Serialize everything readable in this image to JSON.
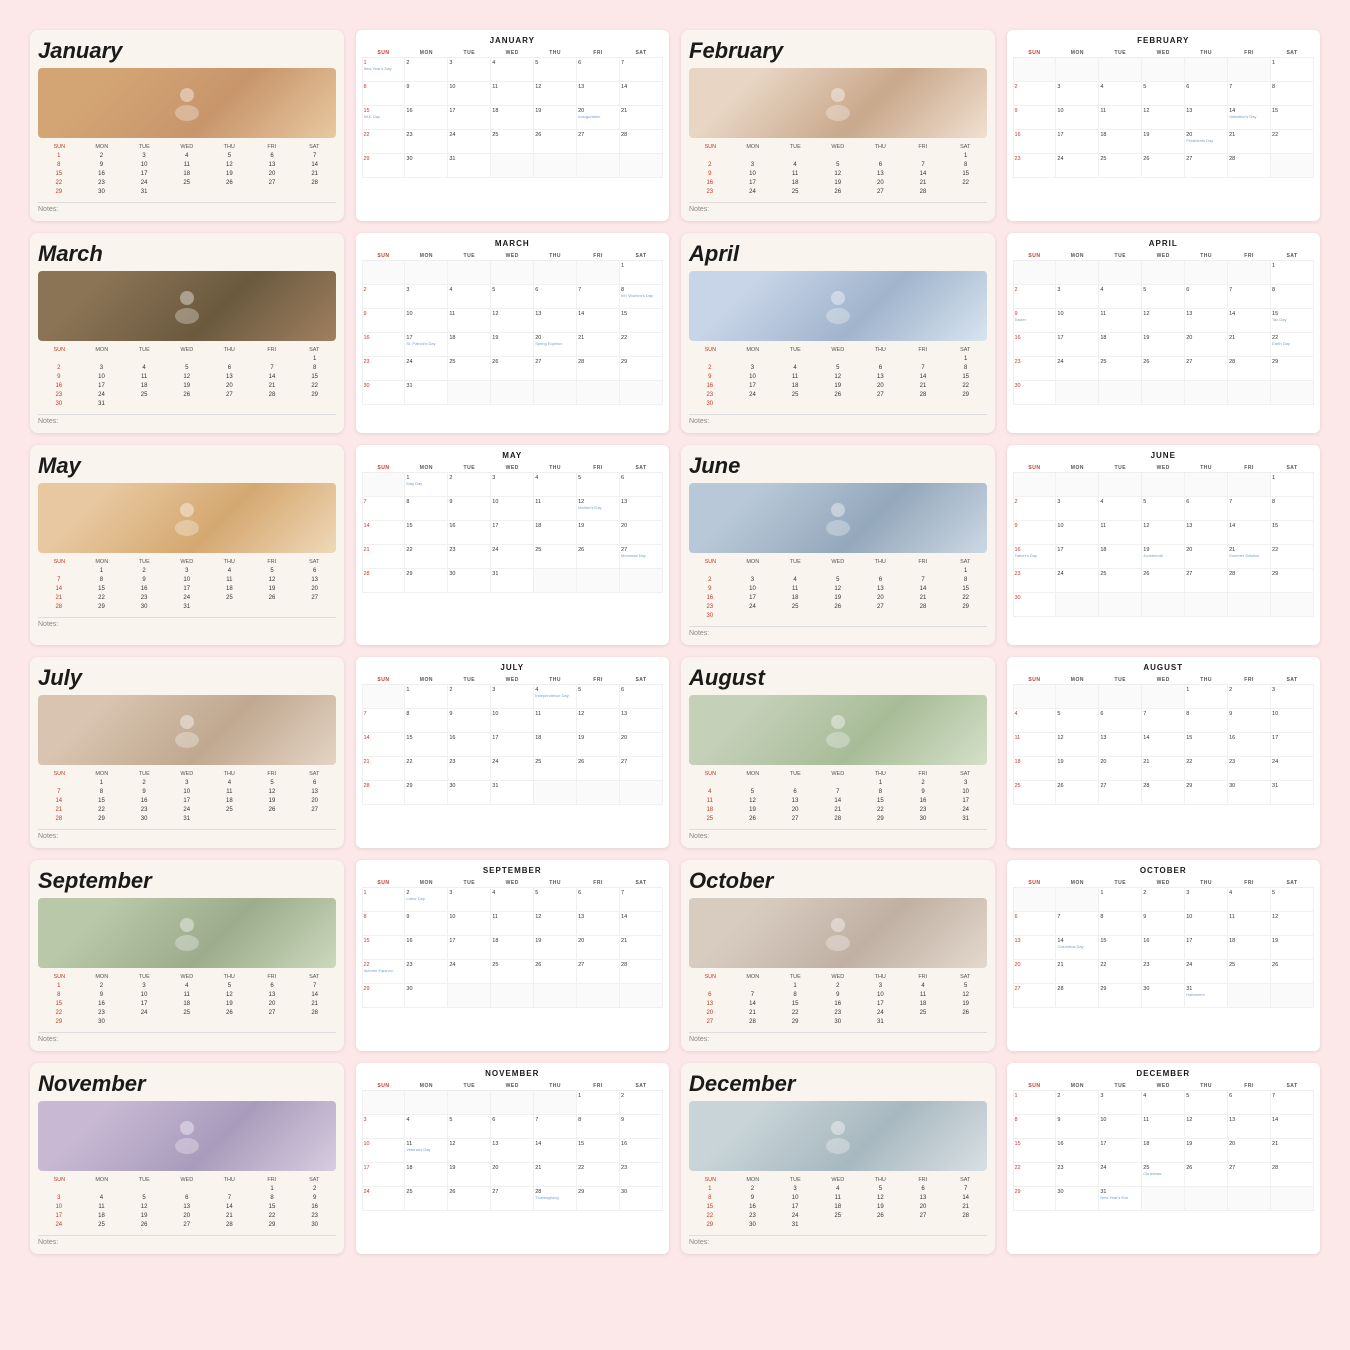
{
  "months": [
    {
      "id": "jan",
      "name": "January",
      "photoClass": "photo-jan",
      "photoLabel": "Woman at desk",
      "days": [
        1,
        2,
        3,
        4,
        5,
        6,
        7,
        8,
        9,
        10,
        11,
        12,
        13,
        14,
        15,
        16,
        17,
        18,
        19,
        20,
        21,
        22,
        23,
        24,
        25,
        26,
        27,
        28,
        29,
        30,
        31
      ],
      "startDay": 0,
      "events": {
        "1": "New Year's Day",
        "15": "MLK Day",
        "20": "Inauguration"
      }
    },
    {
      "id": "feb",
      "name": "February",
      "photoClass": "photo-feb",
      "photoLabel": "Women collaborating",
      "days": [
        1,
        2,
        3,
        4,
        5,
        6,
        7,
        8,
        9,
        10,
        11,
        12,
        13,
        14,
        15,
        16,
        17,
        18,
        19,
        20,
        21,
        22,
        23,
        24,
        25,
        26,
        27,
        28
      ],
      "startDay": 6,
      "events": {
        "14": "Valentine's Day",
        "20": "Presidents Day"
      }
    },
    {
      "id": "mar",
      "name": "March",
      "photoClass": "photo-mar",
      "photoLabel": "Women with laptops",
      "days": [
        1,
        2,
        3,
        4,
        5,
        6,
        7,
        8,
        9,
        10,
        11,
        12,
        13,
        14,
        15,
        16,
        17,
        18,
        19,
        20,
        21,
        22,
        23,
        24,
        25,
        26,
        27,
        28,
        29,
        30,
        31
      ],
      "startDay": 6,
      "events": {
        "8": "Int'l Women's Day",
        "17": "St. Patrick's Day",
        "20": "Spring Equinox"
      }
    },
    {
      "id": "apr",
      "name": "April",
      "photoClass": "photo-apr",
      "photoLabel": "Team meeting",
      "days": [
        1,
        2,
        3,
        4,
        5,
        6,
        7,
        8,
        9,
        10,
        11,
        12,
        13,
        14,
        15,
        16,
        17,
        18,
        19,
        20,
        21,
        22,
        23,
        24,
        25,
        26,
        27,
        28,
        29,
        30
      ],
      "startDay": 6,
      "events": {
        "9": "Easter",
        "15": "Tax Day",
        "22": "Earth Day"
      }
    },
    {
      "id": "may",
      "name": "May",
      "photoClass": "photo-may",
      "photoLabel": "Women working together",
      "days": [
        1,
        2,
        3,
        4,
        5,
        6,
        7,
        8,
        9,
        10,
        11,
        12,
        13,
        14,
        15,
        16,
        17,
        18,
        19,
        20,
        21,
        22,
        23,
        24,
        25,
        26,
        27,
        28,
        29,
        30,
        31
      ],
      "startDay": 1,
      "events": {
        "1": "May Day",
        "12": "Mother's Day",
        "27": "Memorial Day"
      }
    },
    {
      "id": "jun",
      "name": "June",
      "photoClass": "photo-jun",
      "photoLabel": "Women at computers",
      "days": [
        1,
        2,
        3,
        4,
        5,
        6,
        7,
        8,
        9,
        10,
        11,
        12,
        13,
        14,
        15,
        16,
        17,
        18,
        19,
        20,
        21,
        22,
        23,
        24,
        25,
        26,
        27,
        28,
        29,
        30
      ],
      "startDay": 6,
      "events": {
        "16": "Father's Day",
        "19": "Juneteenth",
        "21": "Summer Solstice"
      }
    },
    {
      "id": "jul",
      "name": "July",
      "photoClass": "photo-jul",
      "photoLabel": "Professional woman",
      "days": [
        1,
        2,
        3,
        4,
        5,
        6,
        7,
        8,
        9,
        10,
        11,
        12,
        13,
        14,
        15,
        16,
        17,
        18,
        19,
        20,
        21,
        22,
        23,
        24,
        25,
        26,
        27,
        28,
        29,
        30,
        31
      ],
      "startDay": 1,
      "events": {
        "4": "Independence Day"
      }
    },
    {
      "id": "aug",
      "name": "August",
      "photoClass": "photo-aug",
      "photoLabel": "Woman at office",
      "days": [
        1,
        2,
        3,
        4,
        5,
        6,
        7,
        8,
        9,
        10,
        11,
        12,
        13,
        14,
        15,
        16,
        17,
        18,
        19,
        20,
        21,
        22,
        23,
        24,
        25,
        26,
        27,
        28,
        29,
        30,
        31
      ],
      "startDay": 4,
      "events": {}
    },
    {
      "id": "sep",
      "name": "September",
      "photoClass": "photo-sep",
      "photoLabel": "Business meeting",
      "days": [
        1,
        2,
        3,
        4,
        5,
        6,
        7,
        8,
        9,
        10,
        11,
        12,
        13,
        14,
        15,
        16,
        17,
        18,
        19,
        20,
        21,
        22,
        23,
        24,
        25,
        26,
        27,
        28,
        29,
        30
      ],
      "startDay": 0,
      "events": {
        "2": "Labor Day",
        "22": "Autumn Equinox"
      }
    },
    {
      "id": "oct",
      "name": "October",
      "photoClass": "photo-oct",
      "photoLabel": "Team presentation",
      "days": [
        1,
        2,
        3,
        4,
        5,
        6,
        7,
        8,
        9,
        10,
        11,
        12,
        13,
        14,
        15,
        16,
        17,
        18,
        19,
        20,
        21,
        22,
        23,
        24,
        25,
        26,
        27,
        28,
        29,
        30,
        31
      ],
      "startDay": 2,
      "events": {
        "14": "Columbus Day",
        "31": "Halloween"
      }
    },
    {
      "id": "nov",
      "name": "November",
      "photoClass": "photo-nov",
      "photoLabel": "Office colleagues",
      "days": [
        1,
        2,
        3,
        4,
        5,
        6,
        7,
        8,
        9,
        10,
        11,
        12,
        13,
        14,
        15,
        16,
        17,
        18,
        19,
        20,
        21,
        22,
        23,
        24,
        25,
        26,
        27,
        28,
        29,
        30
      ],
      "startDay": 5,
      "events": {
        "11": "Veterans Day",
        "28": "Thanksgiving"
      }
    },
    {
      "id": "dec",
      "name": "December",
      "photoClass": "photo-dec",
      "photoLabel": "Business duo",
      "days": [
        1,
        2,
        3,
        4,
        5,
        6,
        7,
        8,
        9,
        10,
        11,
        12,
        13,
        14,
        15,
        16,
        17,
        18,
        19,
        20,
        21,
        22,
        23,
        24,
        25,
        26,
        27,
        28,
        29,
        30,
        31
      ],
      "startDay": 0,
      "events": {
        "25": "Christmas",
        "31": "New Year's Eve"
      }
    }
  ],
  "dayHeaders": [
    "SUN",
    "MON",
    "TUE",
    "WED",
    "THU",
    "FRI",
    "SAT"
  ],
  "notesLabel": "Notes:"
}
